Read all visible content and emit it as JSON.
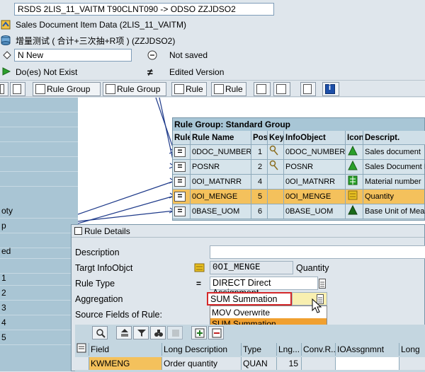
{
  "header": {
    "rsds_value": "RSDS 2LIS_11_VAITM T90CLNT090 -> ODSO ZZJDSO2",
    "source_label": "Sales Document Item Data (2LIS_11_VAITM)",
    "target_label": "增量测试 ( 合计+三次抽+R项 )  (ZZJDSO2)",
    "version_value": "N New",
    "save_status": "Not saved",
    "existence_status": "Do(es) Not Exist",
    "version_status": "Edited Version"
  },
  "toolbar": {
    "rule_group_label": "Rule Group",
    "rule_group_delete_label": "Rule Group",
    "rule_label": "Rule",
    "rule_delete_label": "Rule"
  },
  "left_pane": {
    "rows": [
      "",
      "",
      "",
      "",
      "",
      "",
      "oty",
      "p",
      "",
      "ed",
      "",
      "",
      "1",
      "2",
      "3",
      "4",
      "5"
    ]
  },
  "rule_group": {
    "title": "Rule Group: Standard Group",
    "headers": [
      "Rule",
      "Rule Name",
      "Posi",
      "Key",
      "InfoObject",
      "Icon",
      "Descript."
    ],
    "rows": [
      {
        "name": "0DOC_NUMBER",
        "pos": "1",
        "key": "key",
        "infoobject": "0DOC_NUMBER",
        "desc": "Sales document",
        "selected": false
      },
      {
        "name": "POSNR",
        "pos": "2",
        "key": "key",
        "infoobject": "POSNR",
        "desc": "Sales Document It",
        "selected": false
      },
      {
        "name": "0OI_MATNRR",
        "pos": "4",
        "key": "",
        "infoobject": "0OI_MATNRR",
        "desc": "Material number",
        "selected": false
      },
      {
        "name": "0OI_MENGE",
        "pos": "5",
        "key": "",
        "infoobject": "0OI_MENGE",
        "desc": "Quantity",
        "selected": true
      },
      {
        "name": "0BASE_UOM",
        "pos": "6",
        "key": "",
        "infoobject": "0BASE_UOM",
        "desc": "Base Unit of Meas",
        "selected": false
      }
    ]
  },
  "dialog": {
    "title": "Rule Details",
    "description_label": "Description",
    "description_value": "",
    "target_label": "Targt InfoObjct",
    "target_value": "0OI_MENGE",
    "target_text": "Quantity",
    "rule_type_label": "Rule Type",
    "rule_type_value": "DIRECT Direct Assignment",
    "aggregation_label": "Aggregation",
    "aggregation_value": "SUM Summation",
    "aggregation_options": [
      "MOV Overwrite",
      "SUM Summation"
    ],
    "source_fields_label": "Source Fields of Rule:",
    "table_headers": [
      "Field",
      "Long Description",
      "Type",
      "Lng...",
      "Conv.R...",
      "IOAssgnmnt",
      "Long"
    ],
    "table_row": {
      "field": "KWMENG",
      "long_desc": "Order quantity",
      "type": "QUAN",
      "length": "15"
    }
  },
  "colors": {
    "selected_row": "#f4c15c",
    "dropdown_highlight": "#f0a030",
    "focus_border": "#d4282a"
  }
}
